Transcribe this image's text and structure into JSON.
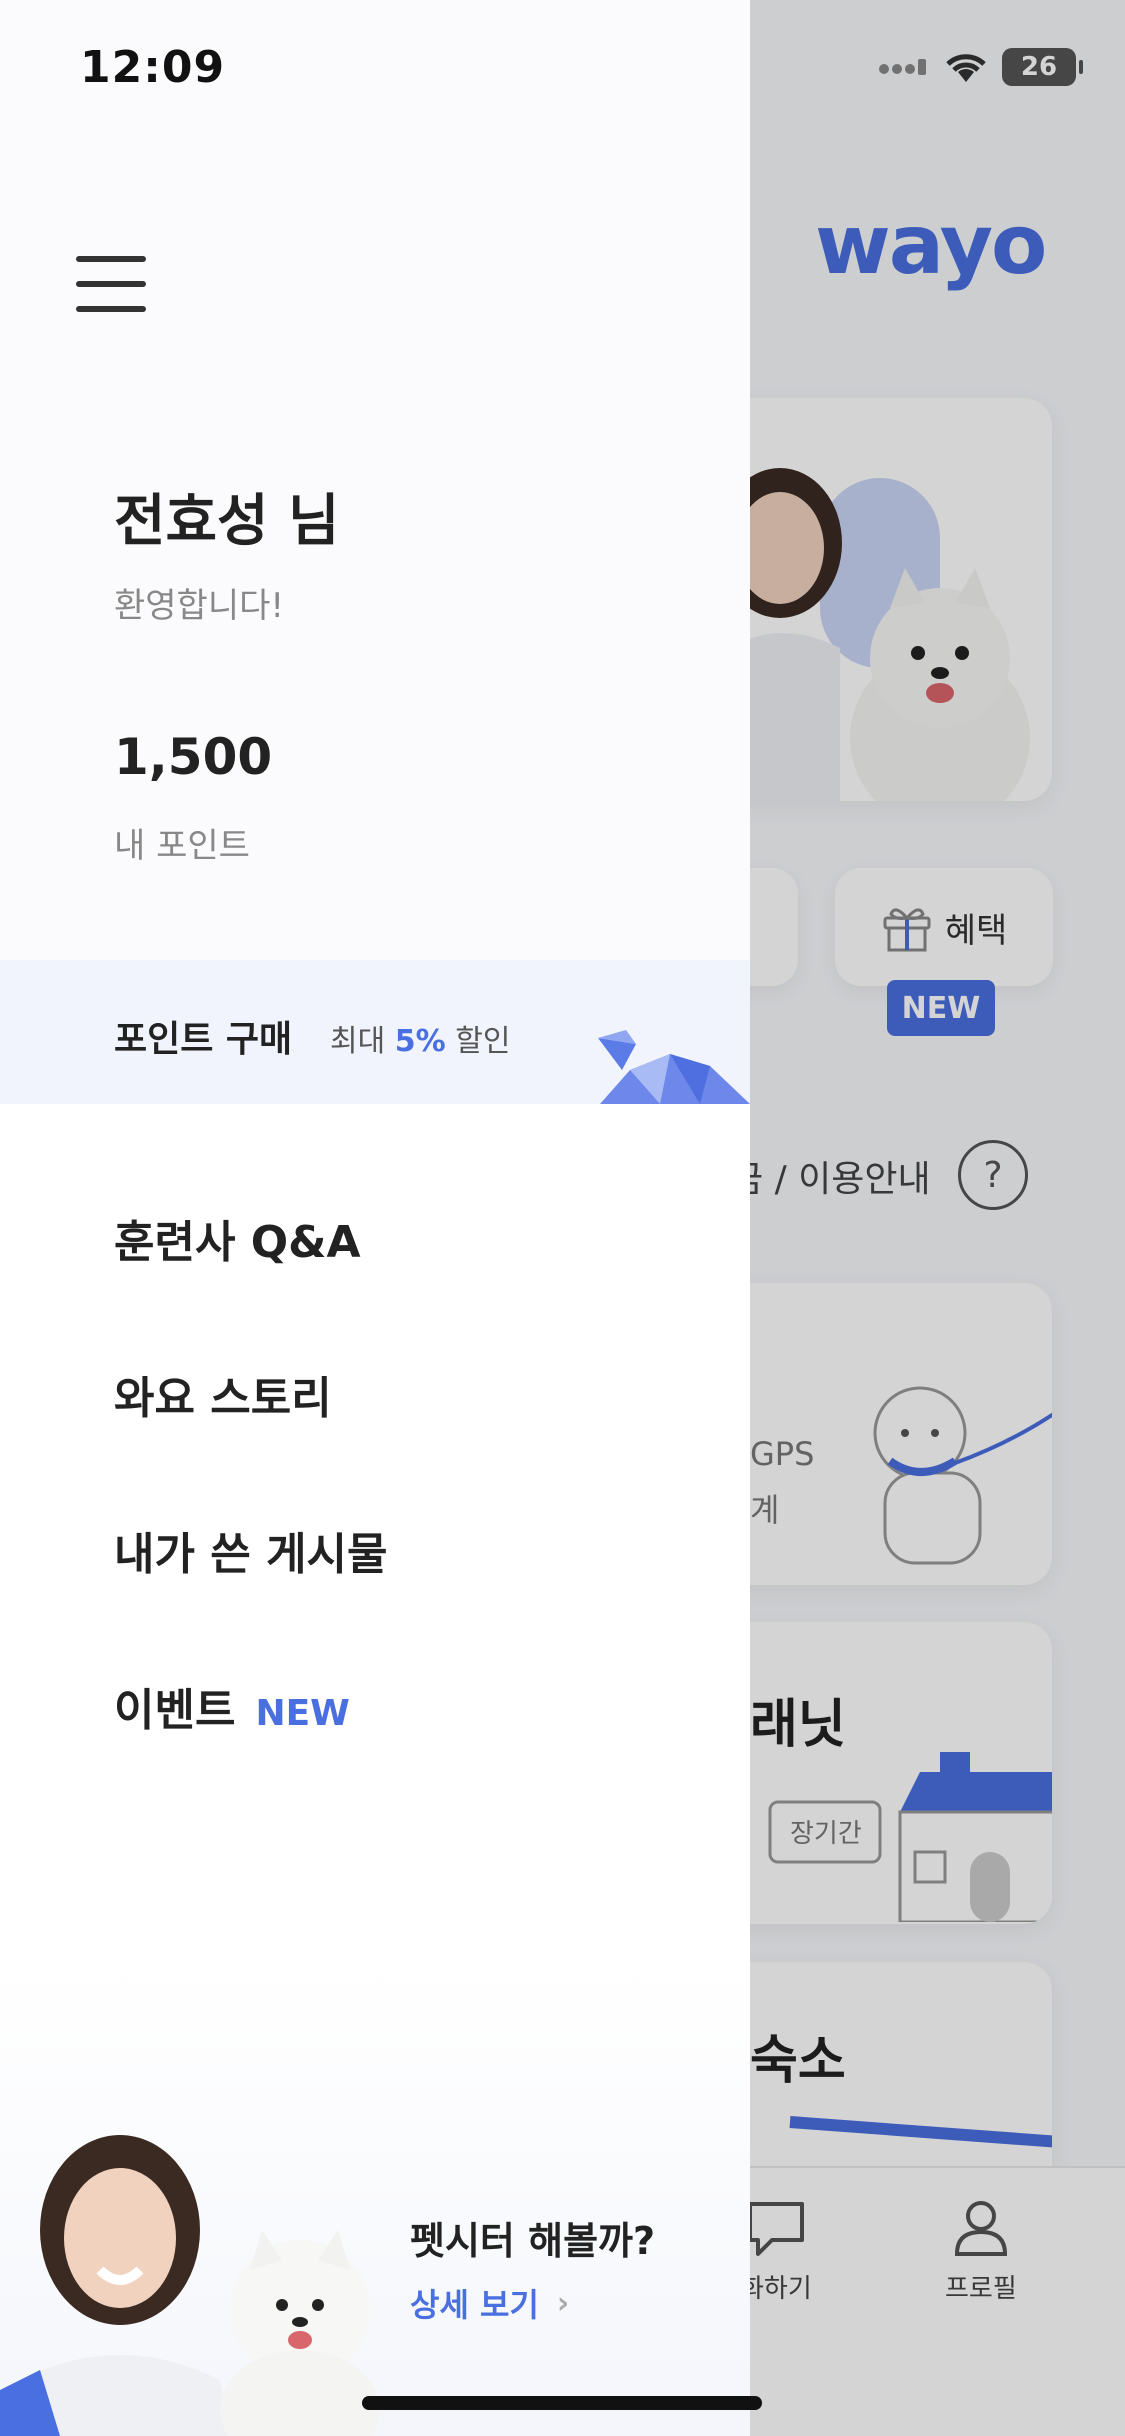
{
  "status_bar": {
    "time": "12:09",
    "battery": "26"
  },
  "background": {
    "logo": "wayo",
    "benefit_label": "혜택",
    "new_badge": "NEW",
    "guide_text": "금 / 이용안내",
    "help_symbol": "?",
    "gps_line1": "GPS",
    "gps_line2": "계",
    "planet_title": "래닛",
    "sign_text": "장기간",
    "stay_title": "숙소",
    "tabs": [
      {
        "label": "화하기",
        "icon": "chat-bubble-icon"
      },
      {
        "label": "프로필",
        "icon": "person-icon"
      }
    ]
  },
  "drawer": {
    "user_name": "전효성 님",
    "welcome": "환영합니다!",
    "points": "1,500",
    "points_label": "내 포인트",
    "buy": {
      "title": "포인트 구매",
      "prefix": "최대",
      "percent": "5%",
      "suffix": "할인"
    },
    "menu": [
      {
        "label": "훈련사 Q&A"
      },
      {
        "label": "와요 스토리"
      },
      {
        "label": "내가 쓴 게시물"
      },
      {
        "label": "이벤트",
        "badge": "NEW"
      }
    ],
    "promo": {
      "question": "펫시터 해볼까?",
      "link": "상세 보기"
    }
  },
  "colors": {
    "accent": "#4a6fe0",
    "text": "#222222",
    "muted": "#888888",
    "banner_bg": "#f1f4fc"
  }
}
